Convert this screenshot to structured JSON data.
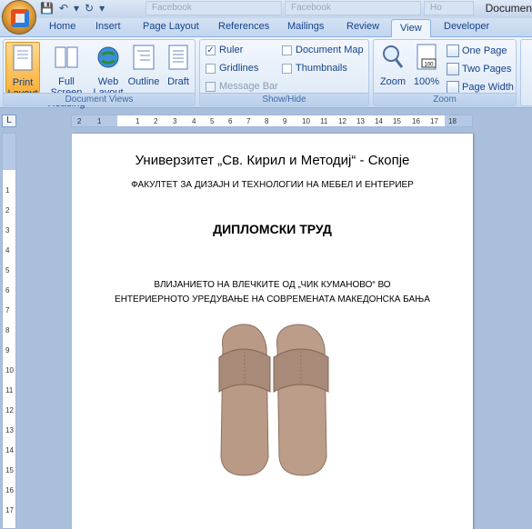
{
  "window": {
    "doc_title": "Documen"
  },
  "browser_tabs": [
    "Facebook",
    "Facebook",
    "Ho"
  ],
  "ribbon_tabs": [
    "Home",
    "Insert",
    "Page Layout",
    "References",
    "Mailings",
    "Review",
    "View",
    "Developer"
  ],
  "active_tab": "View",
  "groups": {
    "document_views": {
      "label": "Document Views",
      "buttons": {
        "print_layout": "Print\nLayout",
        "full_screen": "Full Screen\nReading",
        "web_layout": "Web\nLayout",
        "outline": "Outline",
        "draft": "Draft"
      }
    },
    "show_hide": {
      "label": "Show/Hide",
      "ruler": "Ruler",
      "gridlines": "Gridlines",
      "message_bar": "Message Bar",
      "document_map": "Document Map",
      "thumbnails": "Thumbnails",
      "ruler_checked": "✓"
    },
    "zoom": {
      "label": "Zoom",
      "zoom": "Zoom",
      "hundred": "100%",
      "one_page": "One Page",
      "two_pages": "Two Pages",
      "page_width": "Page Width",
      "hundred_icon_text": "100"
    }
  },
  "ruler": {
    "corner": "L",
    "h_ticks": [
      "2",
      "1",
      "1",
      "2",
      "3",
      "4",
      "5",
      "6",
      "7",
      "8",
      "9",
      "10",
      "11",
      "12",
      "13",
      "14",
      "15",
      "16",
      "17",
      "18"
    ],
    "v_ticks": [
      "1",
      "2",
      "3",
      "4",
      "5",
      "6",
      "7",
      "8",
      "9",
      "10",
      "11",
      "12",
      "13",
      "14",
      "15",
      "16",
      "17"
    ]
  },
  "document": {
    "university": "Универзитет „Св. Кирил и Методиј“ - Скопје",
    "faculty": "ФАКУЛТЕТ ЗА ДИЗАЈН И ТЕХНОЛОГИИ НА МЕБЕЛ И ЕНТЕРИЕР",
    "thesis": "ДИПЛОМСКИ ТРУД",
    "topic_line1": "ВЛИЈАНИЕТО НА ВЛЕЧКИТЕ ОД „ЧИК КУМАНОВО“ ВО",
    "topic_line2": "ЕНТЕРИЕРНОТО УРЕДУВАЊЕ НА СОВРЕМЕНАТА МАКЕДОНСКА БАЊА"
  },
  "colors": {
    "accent": "#15428b",
    "active_btn": "#fbb03a",
    "slipper": "#b89a87"
  }
}
